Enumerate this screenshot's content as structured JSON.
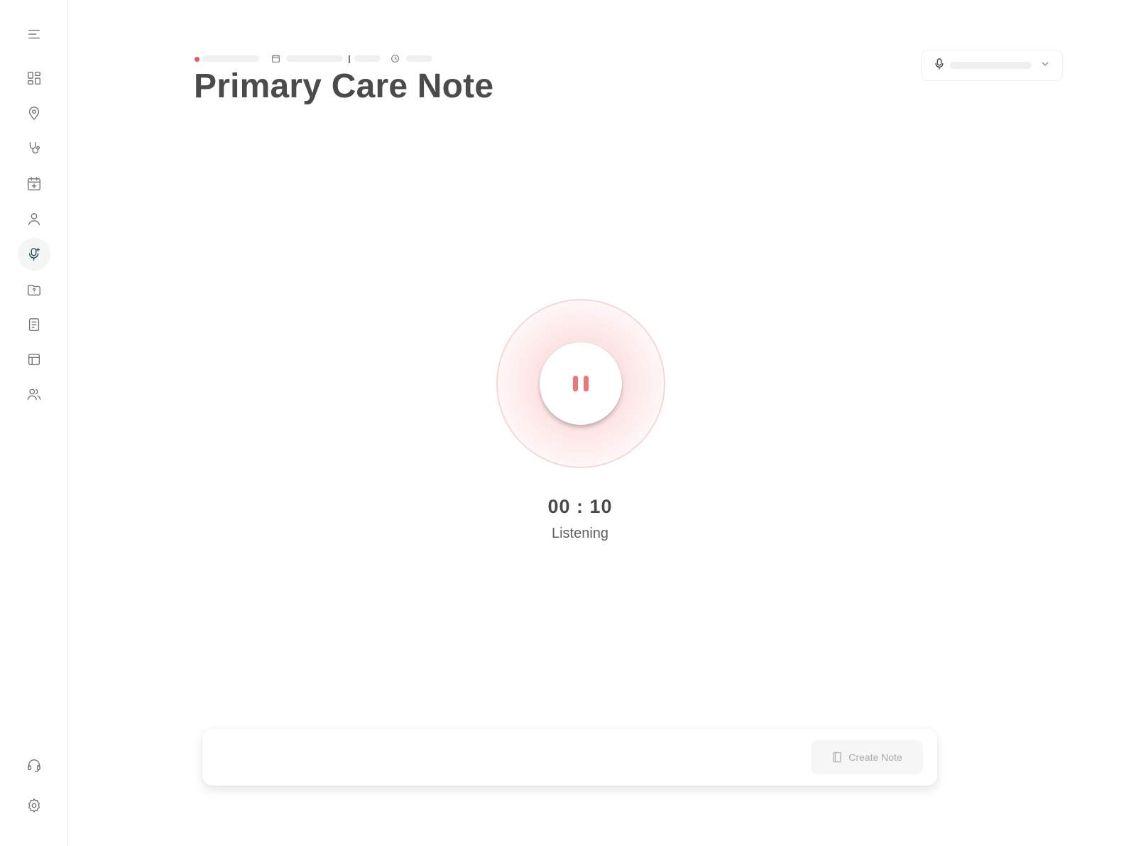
{
  "app": {
    "page_title": "Primary Care Note"
  },
  "recording": {
    "timer": "00 : 10",
    "status": "Listening",
    "accent_color": "#e8787a",
    "indicator_color": "#e85b5b"
  },
  "bottom_bar": {
    "create_note_label": "Create Note"
  },
  "sidebar": {
    "items": [
      {
        "icon": "menu-icon"
      },
      {
        "icon": "dashboard-icon"
      },
      {
        "icon": "location-pin-icon"
      },
      {
        "icon": "stethoscope-icon"
      },
      {
        "icon": "calendar-add-icon"
      },
      {
        "icon": "user-icon"
      },
      {
        "icon": "mic-sparkle-icon",
        "active": true
      },
      {
        "icon": "folder-question-icon"
      },
      {
        "icon": "document-icon"
      },
      {
        "icon": "table-icon"
      },
      {
        "icon": "users-icon"
      },
      {
        "icon": "headset-icon"
      },
      {
        "icon": "settings-icon"
      }
    ]
  }
}
